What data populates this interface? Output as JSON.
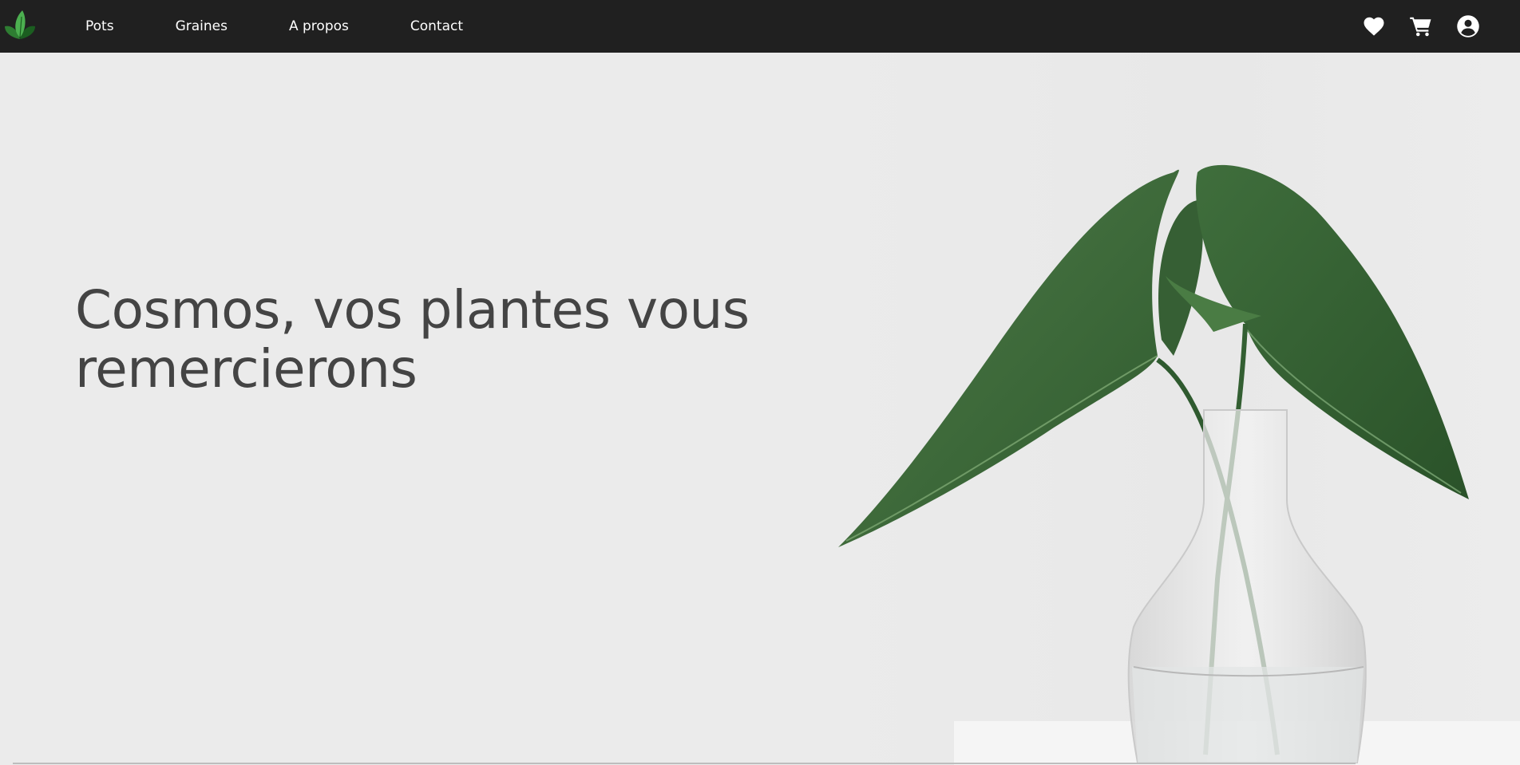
{
  "navbar": {
    "logo_icon": "leaf-logo-icon",
    "links": [
      {
        "label": "Pots"
      },
      {
        "label": "Graines"
      },
      {
        "label": "A propos"
      },
      {
        "label": "Contact"
      }
    ],
    "icons": [
      "heart-icon",
      "cart-icon",
      "user-circle-icon"
    ]
  },
  "hero": {
    "title_line1": "Cosmos, vos plantes vous",
    "title_line2": "remercierons"
  },
  "colors": {
    "navbar_bg": "#202020",
    "hero_bg": "#ebebeb",
    "title_text": "#444444",
    "leaf_green": "#3b6b3a"
  }
}
